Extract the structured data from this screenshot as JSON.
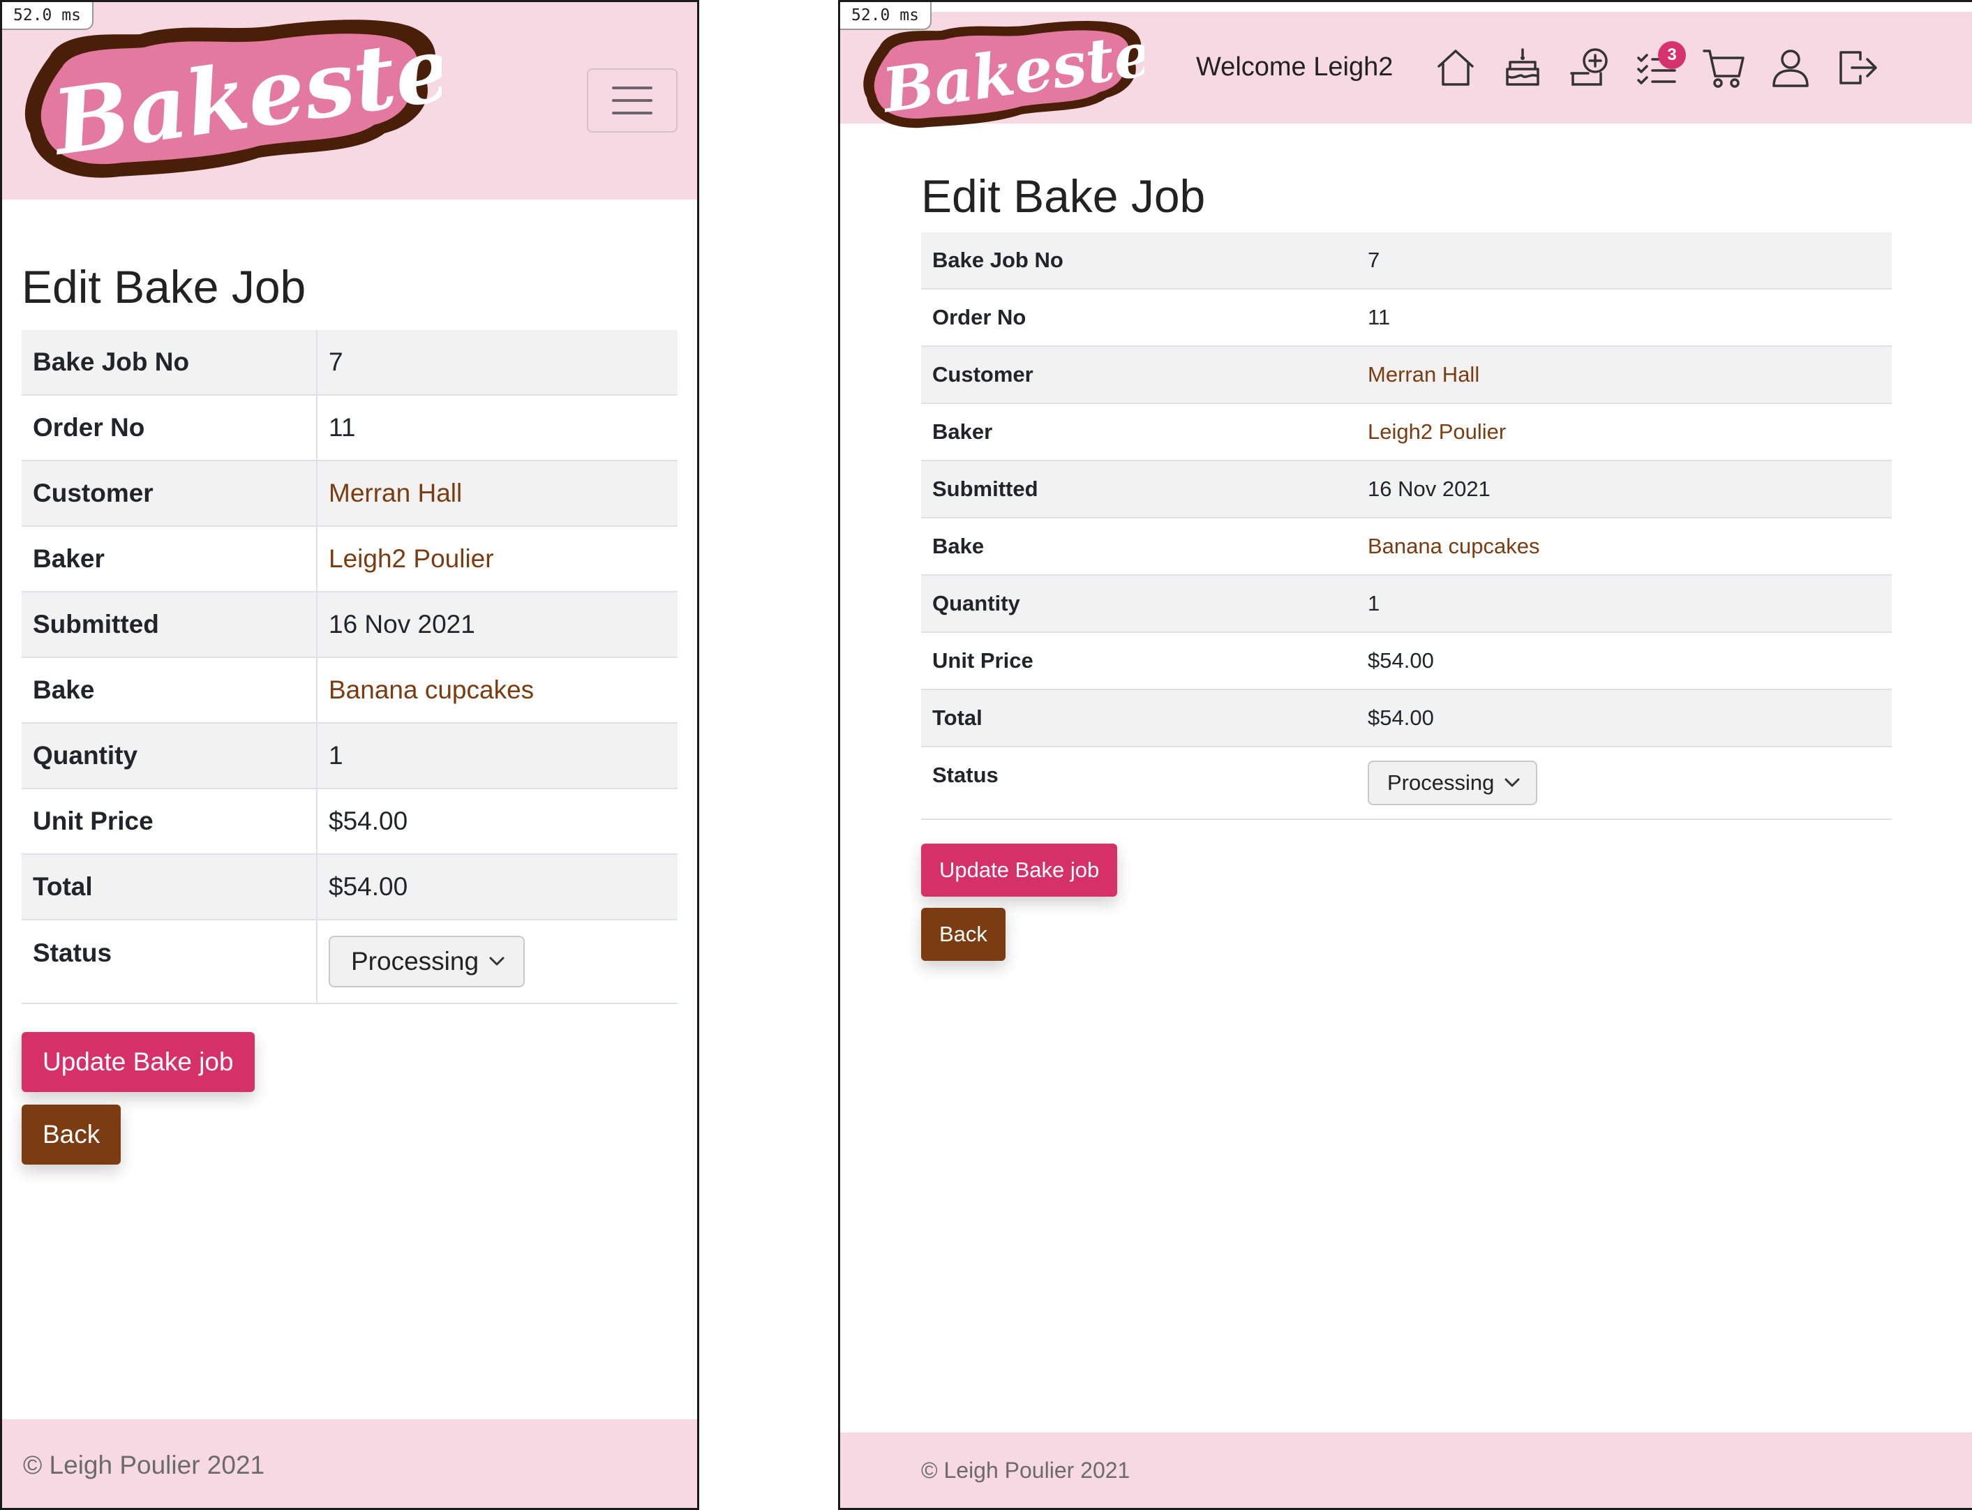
{
  "timing": "52.0 ms",
  "brand": {
    "name": "Bakester",
    "primary_pink": "#d63068",
    "brown": "#7a3c10",
    "nav_bg": "#f7d9e3"
  },
  "nav": {
    "welcome": "Welcome Leigh2",
    "icons": [
      "home-icon",
      "cake-icon",
      "add-bake-icon",
      "tasks-icon",
      "cart-icon",
      "user-icon",
      "logout-icon"
    ],
    "tasks_badge": "3"
  },
  "page": {
    "title": "Edit Bake Job"
  },
  "details": {
    "bake_job_no": {
      "label": "Bake Job No",
      "value": "7"
    },
    "order_no": {
      "label": "Order No",
      "value": "11"
    },
    "customer": {
      "label": "Customer",
      "value": "Merran Hall"
    },
    "baker": {
      "label": "Baker",
      "value": "Leigh2 Poulier"
    },
    "submitted": {
      "label": "Submitted",
      "value": "16 Nov 2021"
    },
    "bake": {
      "label": "Bake",
      "value": "Banana cupcakes"
    },
    "quantity": {
      "label": "Quantity",
      "value": "1"
    },
    "unit_price": {
      "label": "Unit Price",
      "value": "$54.00"
    },
    "total": {
      "label": "Total",
      "value": "$54.00"
    },
    "status": {
      "label": "Status",
      "selected": "Processing"
    }
  },
  "actions": {
    "update": "Update Bake job",
    "back": "Back"
  },
  "footer": {
    "text": "© Leigh Poulier 2021"
  }
}
